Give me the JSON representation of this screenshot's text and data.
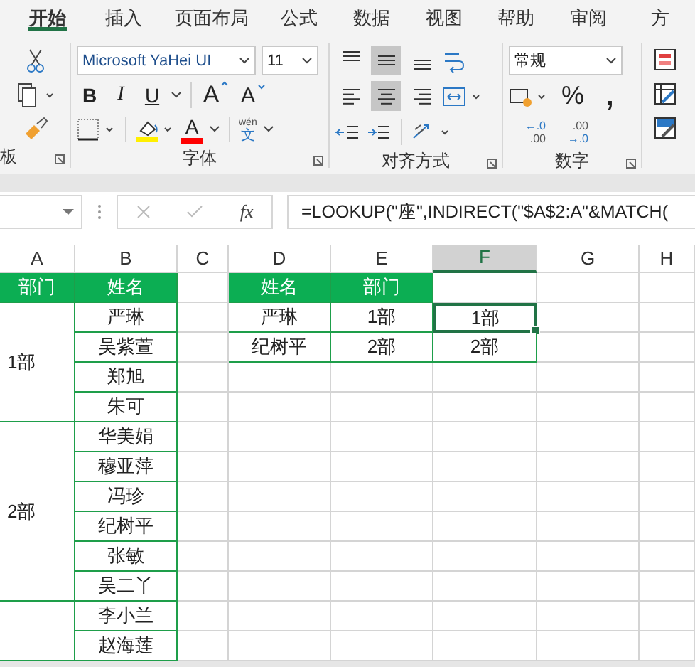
{
  "tabs": [
    {
      "label": "开始",
      "selected": true
    },
    {
      "label": "插入",
      "selected": false
    },
    {
      "label": "页面布局",
      "selected": false
    },
    {
      "label": "公式",
      "selected": false
    },
    {
      "label": "数据",
      "selected": false
    },
    {
      "label": "视图",
      "selected": false
    },
    {
      "label": "帮助",
      "selected": false
    },
    {
      "label": "审阅",
      "selected": false
    },
    {
      "label": "方",
      "selected": false
    }
  ],
  "ribbon": {
    "clipboard_label": "板",
    "font": {
      "label": "字体",
      "name": "Microsoft YaHei UI",
      "size": "11",
      "buttons": [
        {
          "kind": "bold",
          "label": "B"
        },
        {
          "kind": "italic",
          "label": "I"
        },
        {
          "kind": "underline",
          "label": "U"
        },
        {
          "kind": "grow",
          "label": "A"
        },
        {
          "kind": "shrink",
          "label": "A"
        }
      ],
      "font_color_label": "A",
      "phonetic": [
        "wén",
        "文"
      ]
    },
    "alignment": {
      "label": "对齐方式",
      "vertical": [
        {
          "kind": "top",
          "selected": false
        },
        {
          "kind": "middle",
          "selected": true
        },
        {
          "kind": "bottom",
          "selected": false
        }
      ],
      "horizontal": [
        {
          "kind": "left",
          "selected": false
        },
        {
          "kind": "center",
          "selected": true
        },
        {
          "kind": "right",
          "selected": false
        }
      ]
    },
    "number": {
      "label": "数字",
      "format": "常规",
      "percent": "%",
      "comma": ",",
      "increase_decimal": [
        "←.0",
        ".00"
      ],
      "decrease_decimal": [
        ".00",
        "→.0"
      ]
    }
  },
  "formula_bar": {
    "function_label": "fx",
    "formula": "=LOOKUP(\"座\",INDIRECT(\"$A$2:A\"&MATCH("
  },
  "sheet": {
    "columns": [
      {
        "label": "A",
        "selected": false
      },
      {
        "label": "B",
        "selected": false
      },
      {
        "label": "C",
        "selected": false
      },
      {
        "label": "D",
        "selected": false
      },
      {
        "label": "E",
        "selected": false
      },
      {
        "label": "F",
        "selected": true
      },
      {
        "label": "G",
        "selected": false
      },
      {
        "label": "H",
        "selected": false
      }
    ],
    "table": {
      "headers": [
        "部门",
        "姓名"
      ],
      "groups": [
        {
          "department": "1部",
          "names": [
            "严琳",
            "吴紫萱",
            "郑旭",
            "朱可"
          ]
        },
        {
          "department": "2部",
          "names": [
            "华美娟",
            "穆亚萍",
            "冯珍",
            "纪树平",
            "张敏",
            "吴二丫"
          ]
        },
        {
          "names": [
            "李小兰",
            "赵海莲"
          ]
        }
      ]
    },
    "lookup": {
      "headers": [
        "姓名",
        "部门"
      ],
      "rows": [
        {
          "name": "严琳",
          "department": "1部",
          "result": "1部",
          "selected": true
        },
        {
          "name": "纪树平",
          "department": "2部",
          "result": "2部",
          "selected": false
        }
      ]
    }
  }
}
